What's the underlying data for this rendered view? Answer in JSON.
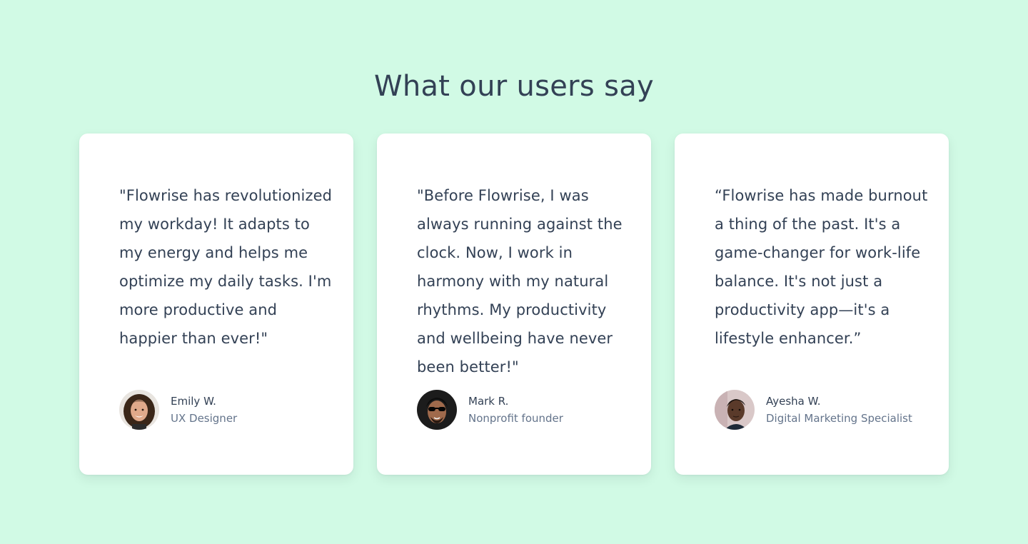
{
  "section": {
    "title": "What our users say"
  },
  "colors": {
    "background": "#d1fae5",
    "card": "#ffffff",
    "text": "#334155",
    "muted": "#64748b"
  },
  "testimonials": [
    {
      "quote": "\"Flowrise has revolutionized my workday! It adapts to my energy and helps me optimize my daily tasks. I'm more productive and happier than ever!\"",
      "name": "Emily W.",
      "role": "UX Designer",
      "avatar": "avatar-photo-woman-curly-hair"
    },
    {
      "quote": "\"Before Flowrise, I was always running against the clock. Now, I work in harmony with my natural rhythms. My productivity and wellbeing have never been better!\"",
      "name": "Mark R.",
      "role": "Nonprofit founder",
      "avatar": "avatar-photo-man-sunglasses"
    },
    {
      "quote": "“Flowrise has made burnout a thing of the past. It's a game-changer for work-life balance. It's not just a productivity app—it's a lifestyle enhancer.”",
      "name": "Ayesha W.",
      "role": "Digital Marketing Specialist",
      "avatar": "avatar-photo-woman-short-hair"
    }
  ]
}
